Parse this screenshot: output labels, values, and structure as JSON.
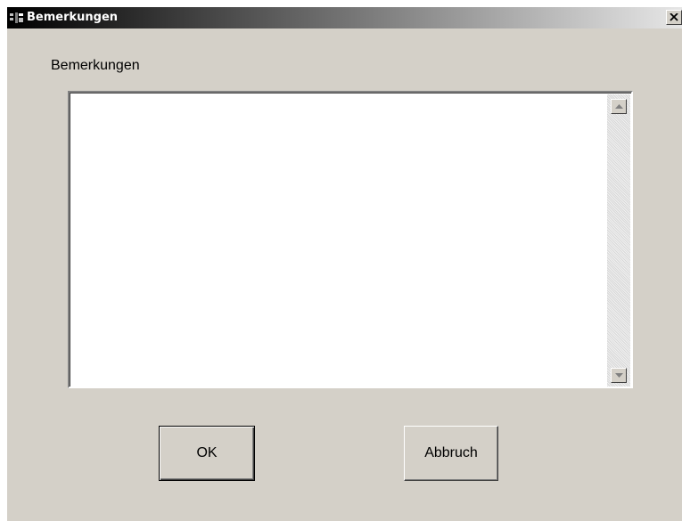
{
  "window": {
    "title": "Bemerkungen",
    "icon": "app-window-icon",
    "close_icon": "close-icon"
  },
  "form": {
    "label": "Bemerkungen",
    "textarea_value": ""
  },
  "buttons": {
    "ok_label": "OK",
    "cancel_label": "Abbruch"
  },
  "colors": {
    "dialog_background": "#d4d0c8",
    "titlebar_start": "#000000",
    "titlebar_end": "#e6e6e6",
    "title_text": "#ffffff"
  }
}
